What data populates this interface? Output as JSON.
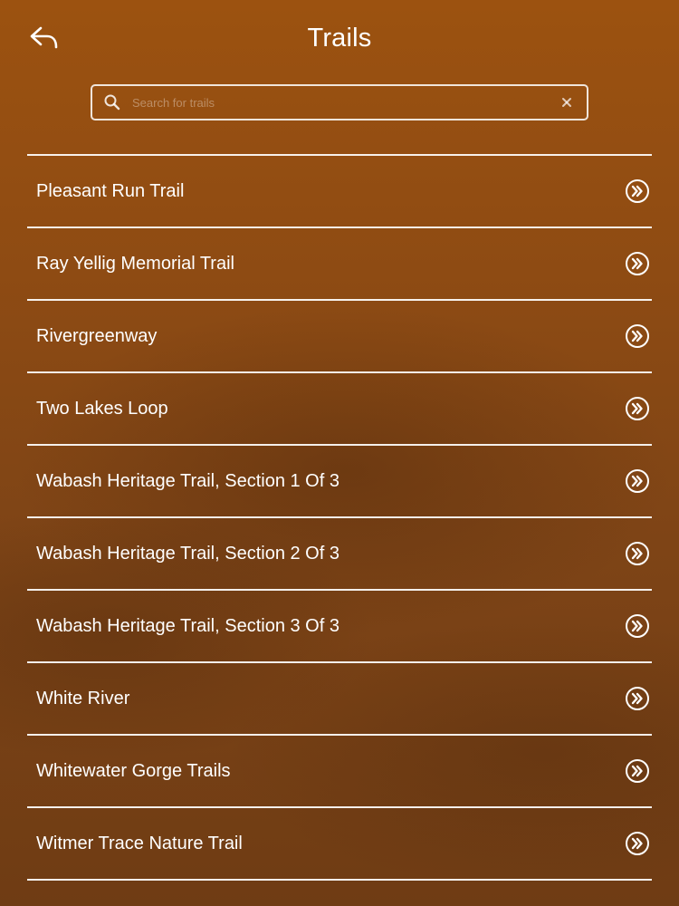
{
  "header": {
    "title": "Trails",
    "back_icon": "back-arrow-icon"
  },
  "search": {
    "placeholder": "Search for trails",
    "value": "",
    "search_icon": "search-icon",
    "clear_icon": "clear-icon"
  },
  "trails": {
    "items": [
      {
        "name": "Pleasant Run Trail"
      },
      {
        "name": "Ray Yellig Memorial Trail"
      },
      {
        "name": "Rivergreenway"
      },
      {
        "name": "Two Lakes Loop"
      },
      {
        "name": "Wabash Heritage Trail, Section 1 Of 3"
      },
      {
        "name": "Wabash Heritage Trail, Section 2 Of 3"
      },
      {
        "name": "Wabash Heritage Trail, Section 3 Of 3"
      },
      {
        "name": "White River"
      },
      {
        "name": "Whitewater Gorge Trails"
      },
      {
        "name": "Witmer Trace Nature Trail"
      }
    ],
    "item_icon": "double-chevron-right-circle-icon"
  },
  "colors": {
    "background_top": "#9c5210",
    "background_bottom": "#6f3c14",
    "text": "#ffffff",
    "divider": "#ffffff"
  }
}
